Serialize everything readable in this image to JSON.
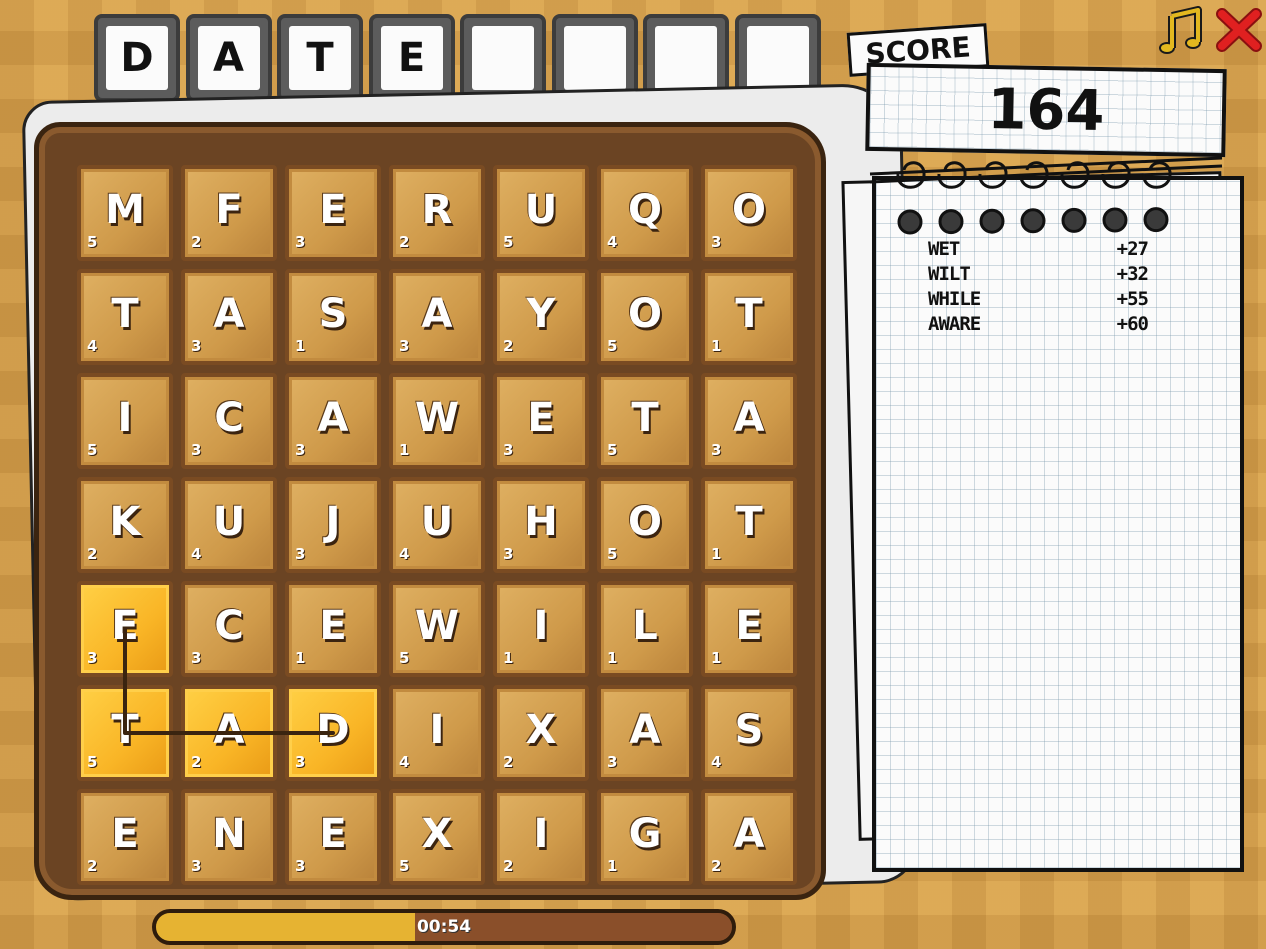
{
  "word_slots": [
    "D",
    "A",
    "T",
    "E",
    "",
    "",
    "",
    ""
  ],
  "board": {
    "rows": [
      [
        {
          "letter": "M",
          "points": "5"
        },
        {
          "letter": "F",
          "points": "2"
        },
        {
          "letter": "E",
          "points": "3"
        },
        {
          "letter": "R",
          "points": "2"
        },
        {
          "letter": "U",
          "points": "5"
        },
        {
          "letter": "Q",
          "points": "4"
        },
        {
          "letter": "O",
          "points": "3"
        }
      ],
      [
        {
          "letter": "T",
          "points": "4"
        },
        {
          "letter": "A",
          "points": "3"
        },
        {
          "letter": "S",
          "points": "1"
        },
        {
          "letter": "A",
          "points": "3"
        },
        {
          "letter": "Y",
          "points": "2"
        },
        {
          "letter": "O",
          "points": "5"
        },
        {
          "letter": "T",
          "points": "1"
        }
      ],
      [
        {
          "letter": "I",
          "points": "5"
        },
        {
          "letter": "C",
          "points": "3"
        },
        {
          "letter": "A",
          "points": "3"
        },
        {
          "letter": "W",
          "points": "1"
        },
        {
          "letter": "E",
          "points": "3"
        },
        {
          "letter": "T",
          "points": "5"
        },
        {
          "letter": "A",
          "points": "3"
        }
      ],
      [
        {
          "letter": "K",
          "points": "2"
        },
        {
          "letter": "U",
          "points": "4"
        },
        {
          "letter": "J",
          "points": "3"
        },
        {
          "letter": "U",
          "points": "4"
        },
        {
          "letter": "H",
          "points": "3"
        },
        {
          "letter": "O",
          "points": "5"
        },
        {
          "letter": "T",
          "points": "1"
        }
      ],
      [
        {
          "letter": "E",
          "points": "3",
          "selected": true
        },
        {
          "letter": "C",
          "points": "3"
        },
        {
          "letter": "E",
          "points": "1"
        },
        {
          "letter": "W",
          "points": "5"
        },
        {
          "letter": "I",
          "points": "1"
        },
        {
          "letter": "L",
          "points": "1"
        },
        {
          "letter": "E",
          "points": "1"
        }
      ],
      [
        {
          "letter": "T",
          "points": "5",
          "selected": true
        },
        {
          "letter": "A",
          "points": "2",
          "selected": true
        },
        {
          "letter": "D",
          "points": "3",
          "selected": true
        },
        {
          "letter": "I",
          "points": "4"
        },
        {
          "letter": "X",
          "points": "2"
        },
        {
          "letter": "A",
          "points": "3"
        },
        {
          "letter": "S",
          "points": "4"
        }
      ],
      [
        {
          "letter": "E",
          "points": "2"
        },
        {
          "letter": "N",
          "points": "3"
        },
        {
          "letter": "E",
          "points": "3"
        },
        {
          "letter": "X",
          "points": "5"
        },
        {
          "letter": "I",
          "points": "2"
        },
        {
          "letter": "G",
          "points": "1"
        },
        {
          "letter": "A",
          "points": "2"
        }
      ]
    ]
  },
  "score": {
    "label": "SCORE",
    "value": "164"
  },
  "found_words": [
    {
      "word": "WET",
      "points": "+27"
    },
    {
      "word": "WILT",
      "points": "+32"
    },
    {
      "word": "WHILE",
      "points": "+55"
    },
    {
      "word": "AWARE",
      "points": "+60"
    }
  ],
  "timer": {
    "text": "00:54",
    "remaining_fraction": 0.45
  },
  "icons": {
    "music": "music-note-icon",
    "close": "close-x-icon"
  },
  "colors": {
    "selected_tile": "#f9b526",
    "tile": "#d9a656",
    "close_red": "#e02020",
    "music_gold": "#e3b81f"
  }
}
